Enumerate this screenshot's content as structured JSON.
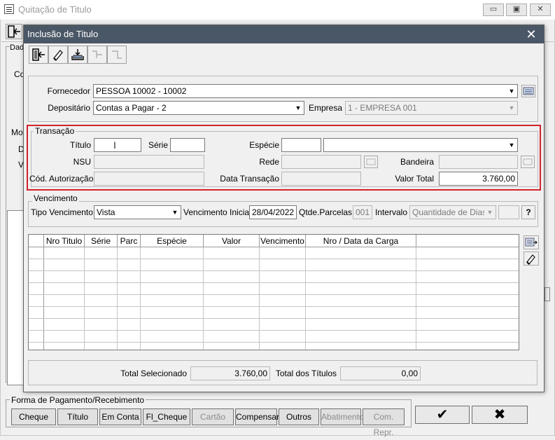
{
  "background_window": {
    "title": "Quitação de Titulo",
    "labels": {
      "dados_prefix": "Dad",
      "co_prefix": "Co",
      "mo_prefix": "Mo",
      "d_prefix": "D",
      "v_prefix": "V"
    },
    "payment_group": {
      "title": "Forma de Pagamento/Recebimento",
      "buttons": [
        {
          "label": "Cheque",
          "enabled": true
        },
        {
          "label": "Título",
          "enabled": true
        },
        {
          "label": "Em Conta",
          "enabled": true
        },
        {
          "label": "Fl_Cheque",
          "enabled": true
        },
        {
          "label": "Cartão",
          "enabled": false
        },
        {
          "label": "Compensar",
          "enabled": true
        },
        {
          "label": "Outros",
          "enabled": true
        },
        {
          "label": "Abatimento",
          "enabled": false
        },
        {
          "label": "Com. Repr.",
          "enabled": false
        }
      ]
    },
    "confirm_symbol": "✔",
    "cancel_symbol": "✖"
  },
  "dialog": {
    "title": "Inclusão de Titulo",
    "close_symbol": "✕",
    "toolbar": [
      {
        "icon": "exit-door-icon",
        "enabled": true
      },
      {
        "icon": "eraser-icon",
        "enabled": true
      },
      {
        "icon": "import-tray-icon",
        "enabled": true
      },
      {
        "icon": "split-icon",
        "enabled": false
      },
      {
        "icon": "merge-icon",
        "enabled": false
      }
    ],
    "header": {
      "fornecedor_label": "Fornecedor",
      "fornecedor_value": "PESSOA 10002 - 10002",
      "depositario_label": "Depositário",
      "depositario_value": "Contas a Pagar - 2",
      "empresa_label": "Empresa",
      "empresa_value": "1 - EMPRESA 001"
    },
    "transacao": {
      "title": "Transação",
      "titulo_label": "Título",
      "titulo_value": "",
      "serie_label": "Série",
      "serie_value": "",
      "especie_label": "Espécie",
      "especie_code": "",
      "especie_value": "",
      "nsu_label": "NSU",
      "nsu_value": "",
      "rede_label": "Rede",
      "rede_value": "",
      "bandeira_label": "Bandeira",
      "bandeira_value": "",
      "cod_autorizacao_label": "Cód. Autorização",
      "cod_autorizacao_value": "",
      "data_transacao_label": "Data Transação",
      "data_transacao_value": "",
      "valor_total_label": "Valor Total",
      "valor_total_value": "3.760,00"
    },
    "vencimento": {
      "title": "Vencimento",
      "tipo_label": "Tipo Vencimento",
      "tipo_value": "Vista",
      "inicial_label": "Vencimento Inicial",
      "inicial_value": "28/04/2022",
      "parcelas_label": "Qtde.Parcelas",
      "parcelas_value": "001",
      "intervalo_label": "Intervalo",
      "intervalo_value": "Quantidade de Dias",
      "intervalo_num": "",
      "help_label": "?"
    },
    "grid": {
      "columns": [
        "Nro Titulo",
        "Série",
        "Parc",
        "Espécie",
        "Valor",
        "Vencimento",
        "Nro / Data da Carga"
      ],
      "rows": []
    },
    "totals": {
      "selecionado_label": "Total Selecionado",
      "selecionado_value": "3.760,00",
      "titulos_label": "Total dos Títulos",
      "titulos_value": "0,00"
    }
  }
}
